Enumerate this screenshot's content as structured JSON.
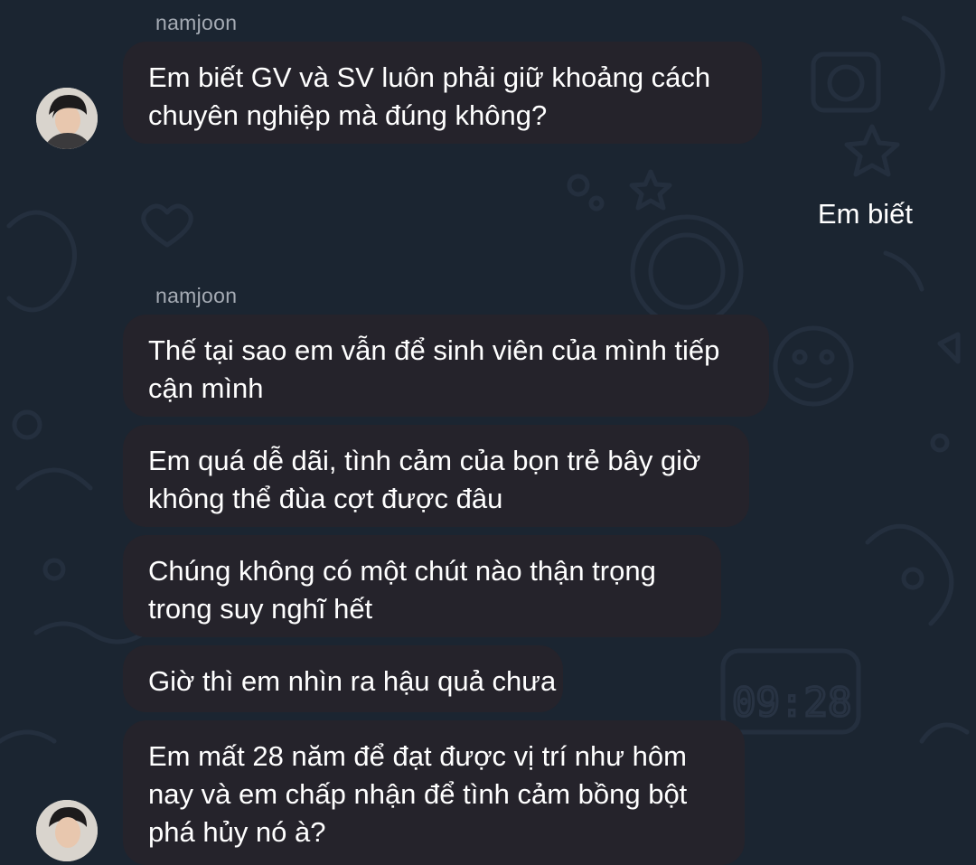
{
  "chat": {
    "groups": [
      {
        "sender": "namjoon",
        "messages": [
          {
            "lines": [
              "Em biết GV và SV luôn phải giữ khoảng cách",
              "chuyên nghiệp mà đúng không?"
            ]
          }
        ]
      },
      {
        "sender": "namjoon",
        "messages": [
          {
            "lines": [
              "Thế tại sao em vẫn để sinh viên của mình tiếp",
              "cận mình"
            ]
          },
          {
            "lines": [
              "Em quá dễ dãi, tình cảm của bọn trẻ bây giờ",
              "không thể đùa cợt được đâu"
            ]
          },
          {
            "lines": [
              "Chúng không có một chút nào thận trọng",
              "trong suy nghĩ hết"
            ]
          },
          {
            "lines": [
              "Giờ thì em nhìn ra hậu quả chưa"
            ]
          },
          {
            "lines": [
              "Em mất 28 năm để đạt được vị trí như hôm",
              "nay và em chấp nhận để tình cảm bồng bột",
              "phá hủy nó à?"
            ]
          }
        ]
      }
    ],
    "self_message": "Em biết"
  },
  "wallpaper": {
    "clock_text": "09:28"
  },
  "colors": {
    "background": "#1b2531",
    "incoming_bubble": "#25232b",
    "sender_name": "#a5abb4",
    "text": "#ffffff"
  }
}
